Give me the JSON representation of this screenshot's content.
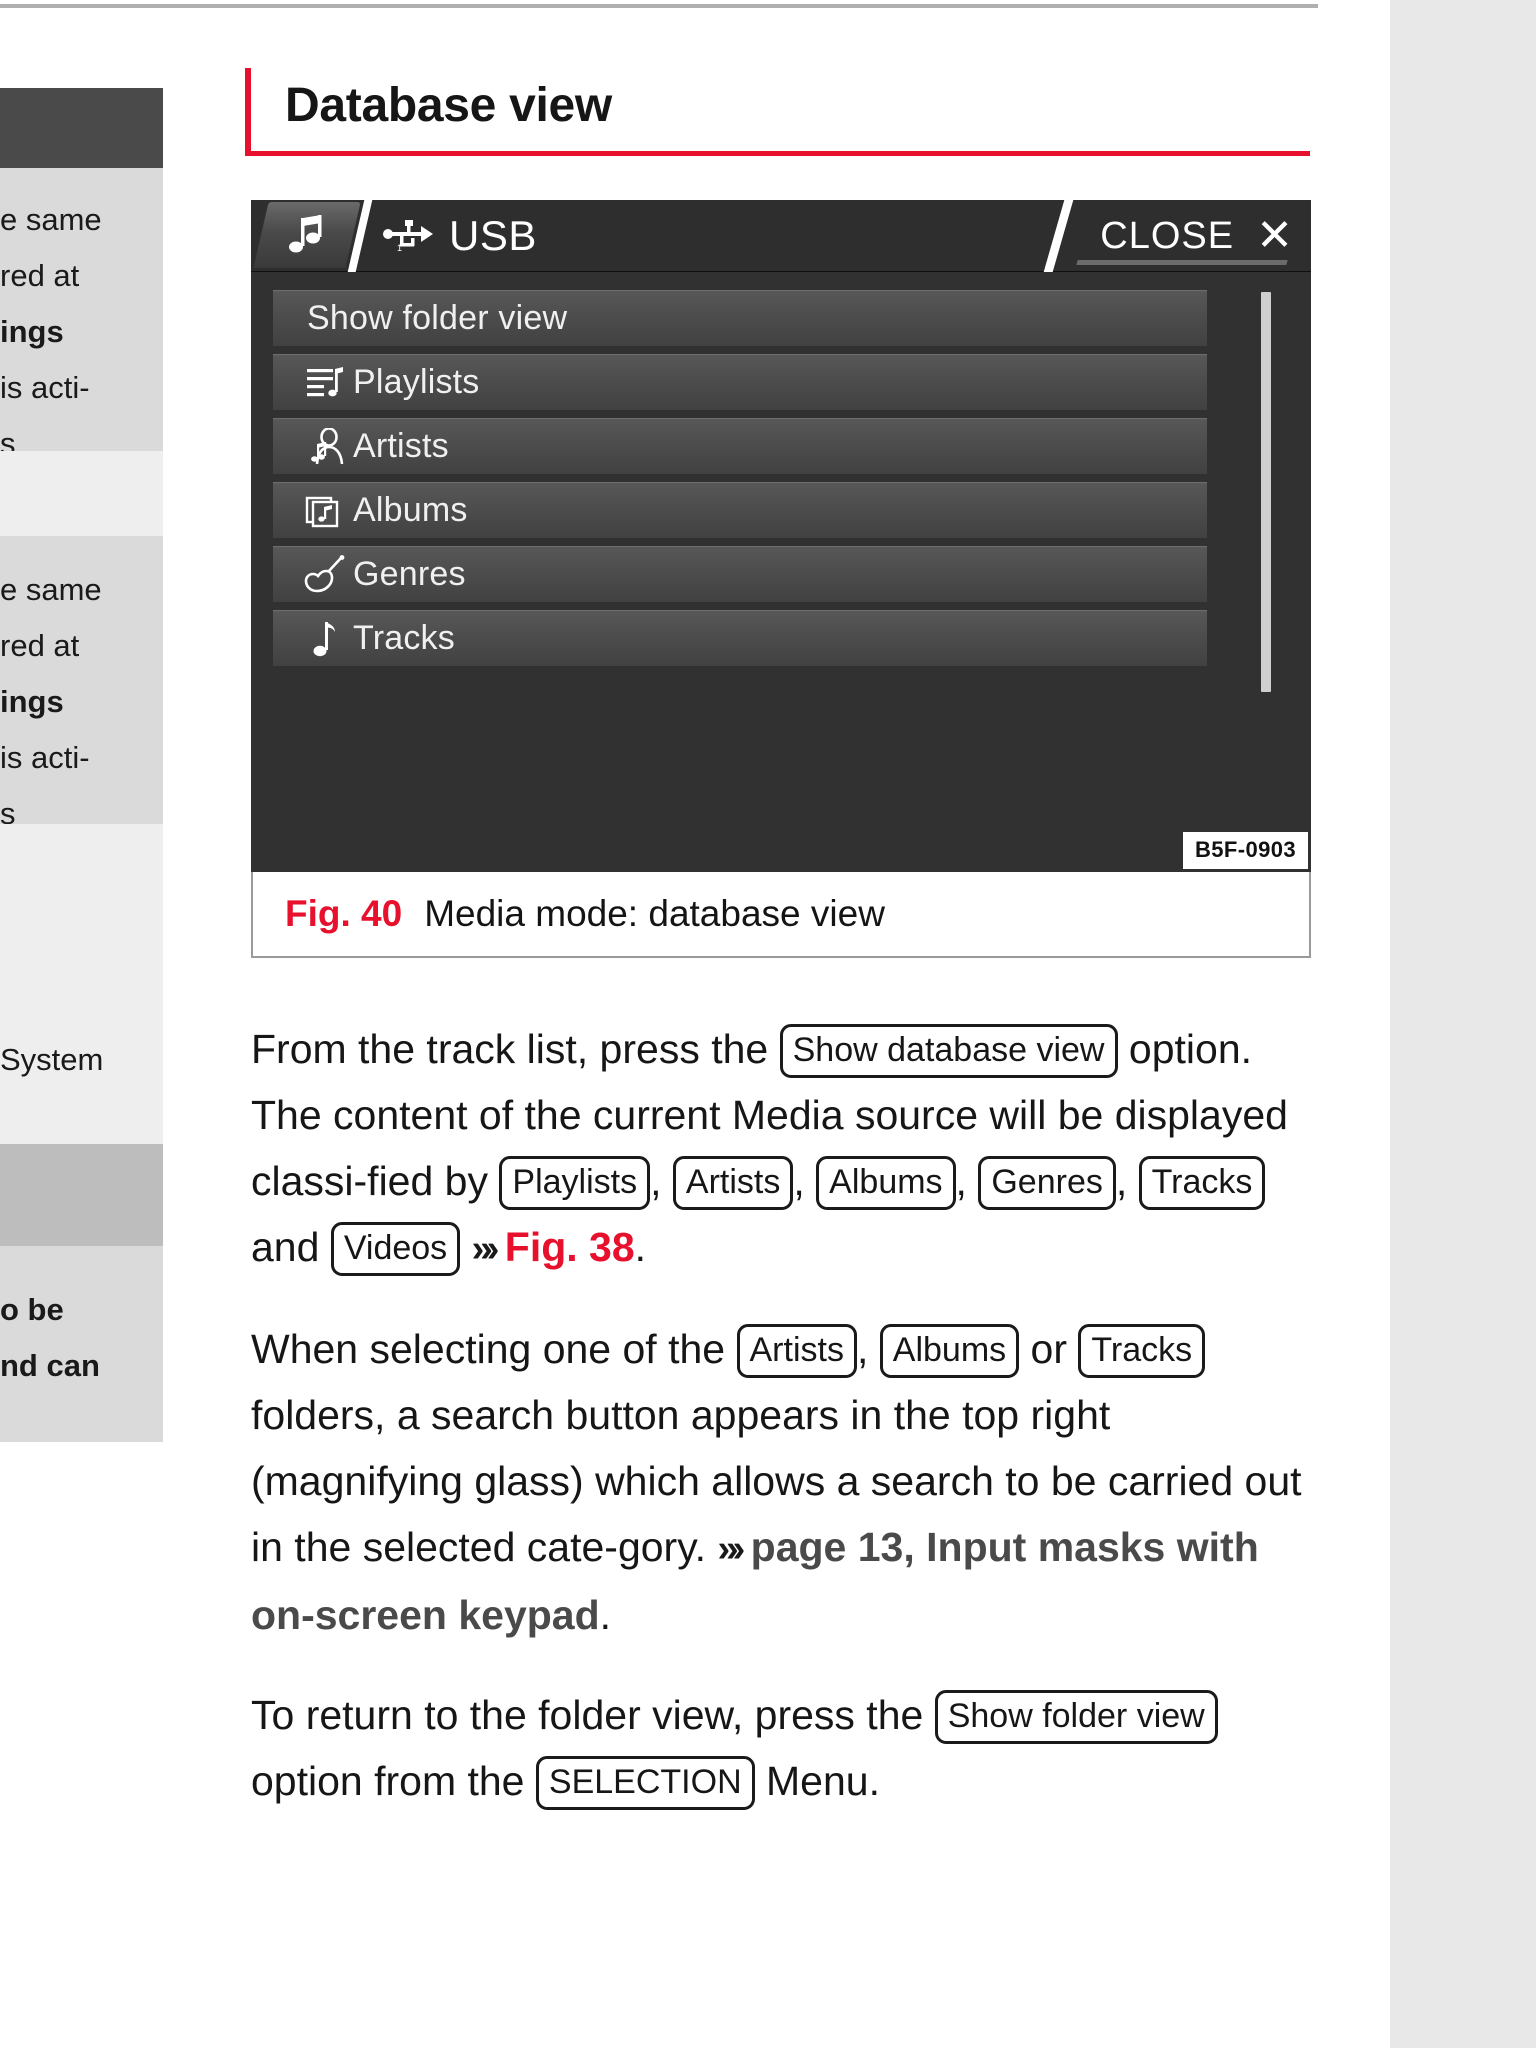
{
  "document": {
    "heading": "Database view"
  },
  "left_column": {
    "blocks": [
      {
        "style": "dark",
        "lines": []
      },
      {
        "style": "gray",
        "lines": [
          "e same",
          "red at",
          "ings",
          "is acti-",
          "s"
        ]
      },
      {
        "style": "light",
        "lines": []
      },
      {
        "style": "gray",
        "lines": [
          "e same",
          "red at",
          "ings",
          "is acti-",
          "s"
        ]
      },
      {
        "style": "light",
        "lines": [
          "System"
        ]
      },
      {
        "style": "mid",
        "lines": []
      },
      {
        "style": "gray",
        "lines": [
          "o be",
          "nd can"
        ]
      }
    ],
    "bold_lines": [
      "ings",
      "o be",
      "nd can"
    ]
  },
  "figure": {
    "device": {
      "header": {
        "music_tab_icon": "music-note-icon",
        "source_icon": "usb-icon",
        "source_label": "USB",
        "close_label": "CLOSE",
        "close_icon": "close-x-icon"
      },
      "list_items": [
        {
          "label": "Show folder view",
          "icon": null
        },
        {
          "label": "Playlists",
          "icon": "playlist-icon"
        },
        {
          "label": "Artists",
          "icon": "artist-icon"
        },
        {
          "label": "Albums",
          "icon": "album-icon"
        },
        {
          "label": "Genres",
          "icon": "guitar-icon"
        },
        {
          "label": "Tracks",
          "icon": "music-note-icon"
        }
      ],
      "image_code": "B5F-0903"
    },
    "caption": {
      "fig_number": "Fig. 40",
      "text": "Media mode: database view"
    }
  },
  "paragraphs": {
    "p1": {
      "t1": "From the track list, press the",
      "btn1": "Show database view",
      "t2": "option. The content of the current Media source will be displayed classi-fied by",
      "btn2": "Playlists",
      "sep2": ",",
      "btn3": "Artists",
      "sep3": ",",
      "btn4": "Albums",
      "sep4": ",",
      "btn5": "Genres",
      "sep5": ",",
      "btn6": "Tracks",
      "t3": "and",
      "btn7": "Videos",
      "arrow": "»›",
      "ref": "Fig. 38",
      "end": "."
    },
    "p2": {
      "t1": "When selecting one of the",
      "btn1": "Artists",
      "sep1": ",",
      "btn2": "Albums",
      "t2": "or",
      "btn3": "Tracks",
      "t3": "folders, a search button appears in the top right (magnifying glass) which allows a search to be carried out in the selected cate-gory.",
      "arrow": "»›",
      "ref": "page 13, Input masks with on-screen keypad",
      "end": "."
    },
    "p3": {
      "t1": "To return to the folder view, press the",
      "btn1": "Show folder view",
      "t2": "option from the",
      "btn2": "SELECTION",
      "t3": "Menu."
    }
  },
  "colors": {
    "accent_red": "#e8112d",
    "device_bg": "#313131",
    "list_item_bg": "#4e4e4e",
    "text": "#161616"
  }
}
